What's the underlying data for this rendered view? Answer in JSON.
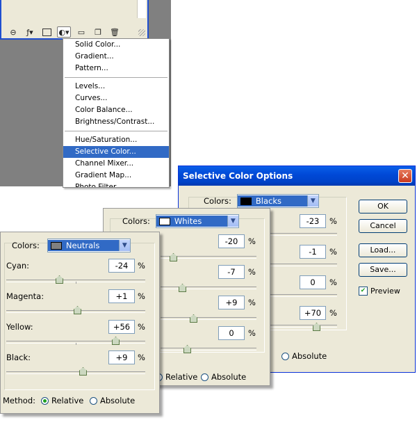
{
  "menu": {
    "groups": [
      [
        "Solid Color...",
        "Gradient...",
        "Pattern..."
      ],
      [
        "Levels...",
        "Curves...",
        "Color Balance...",
        "Brightness/Contrast..."
      ],
      [
        "Hue/Saturation...",
        "Selective Color...",
        "Channel Mixer...",
        "Gradient Map...",
        "Photo Filter..."
      ]
    ],
    "selected": "Selective Color..."
  },
  "dialog": {
    "title": "Selective Color Options",
    "colors_label": "Colors:",
    "color": "Blacks",
    "swatch_color": "#000000",
    "values": [
      "-23",
      "-1",
      "0",
      "+70"
    ],
    "pct": "%",
    "ok_label": "OK",
    "cancel_label": "Cancel",
    "load_label": "Load...",
    "save_label": "Save...",
    "preview_label": "Preview",
    "preview_checked": true,
    "method_absolute": "Absolute"
  },
  "whites_panel": {
    "colors_label": "Colors:",
    "color": "Whites",
    "swatch_color": "#ffffff",
    "values": [
      "-20",
      "-7",
      "+9",
      "0"
    ],
    "pct": "%",
    "method_relative": "Relative",
    "method_absolute": "Absolute"
  },
  "neutrals_panel": {
    "colors_label": "Colors:",
    "color": "Neutrals",
    "swatch_color": "#808080",
    "labels": [
      "Cyan:",
      "Magenta:",
      "Yellow:",
      "Black:"
    ],
    "values": [
      "-24",
      "+1",
      "+56",
      "+9"
    ],
    "pct": "%",
    "method_label": "Method:",
    "method_relative": "Relative",
    "method_absolute": "Absolute",
    "method_selected": "Relative"
  }
}
